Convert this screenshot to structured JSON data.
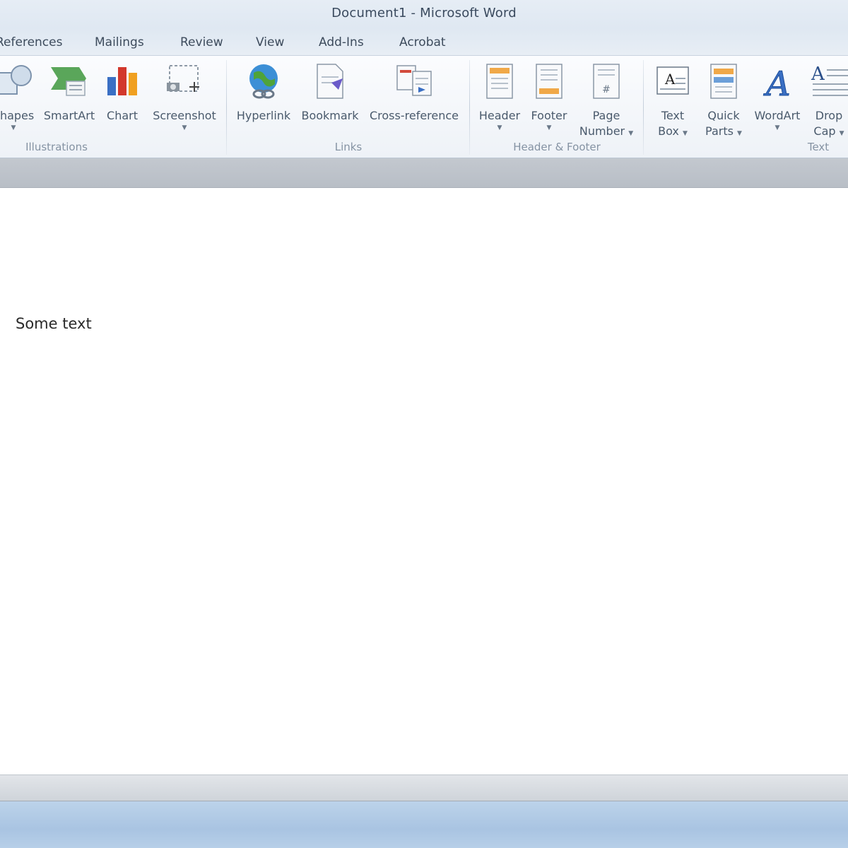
{
  "window": {
    "title": "Document1  -  Microsoft Word"
  },
  "tabs": [
    "References",
    "Mailings",
    "Review",
    "View",
    "Add-Ins",
    "Acrobat"
  ],
  "ribbon": {
    "groups": {
      "illustrations": "Illustrations",
      "links": "Links",
      "header_footer": "Header & Footer",
      "text": "Text"
    },
    "buttons": {
      "shapes": {
        "label": "Shapes",
        "icon": "shapes-icon"
      },
      "smartart": {
        "label": "SmartArt",
        "icon": "smartart-icon"
      },
      "chart": {
        "label": "Chart",
        "icon": "chart-icon"
      },
      "screenshot": {
        "label": "Screenshot",
        "icon": "screenshot-icon"
      },
      "hyperlink": {
        "label": "Hyperlink",
        "icon": "hyperlink-icon"
      },
      "bookmark": {
        "label": "Bookmark",
        "icon": "bookmark-icon"
      },
      "cross_reference": {
        "label": "Cross-reference",
        "icon": "cross-reference-icon"
      },
      "header": {
        "label": "Header",
        "icon": "header-icon"
      },
      "footer": {
        "label": "Footer",
        "icon": "footer-icon"
      },
      "page_number": {
        "line1": "Page",
        "line2": "Number",
        "icon": "page-number-icon"
      },
      "text_box": {
        "line1": "Text",
        "line2": "Box",
        "icon": "text-box-icon"
      },
      "quick_parts": {
        "line1": "Quick",
        "line2": "Parts",
        "icon": "quick-parts-icon"
      },
      "wordart": {
        "label": "WordArt",
        "icon": "wordart-icon"
      },
      "drop_cap": {
        "line1": "Drop",
        "line2": "Cap",
        "icon": "drop-cap-icon"
      }
    }
  },
  "document": {
    "text": "Some text"
  },
  "colors": {
    "ribbon_bg": "#f4f7fb",
    "title_text": "#3a4a5e",
    "taskbar": "#afc8e4"
  }
}
